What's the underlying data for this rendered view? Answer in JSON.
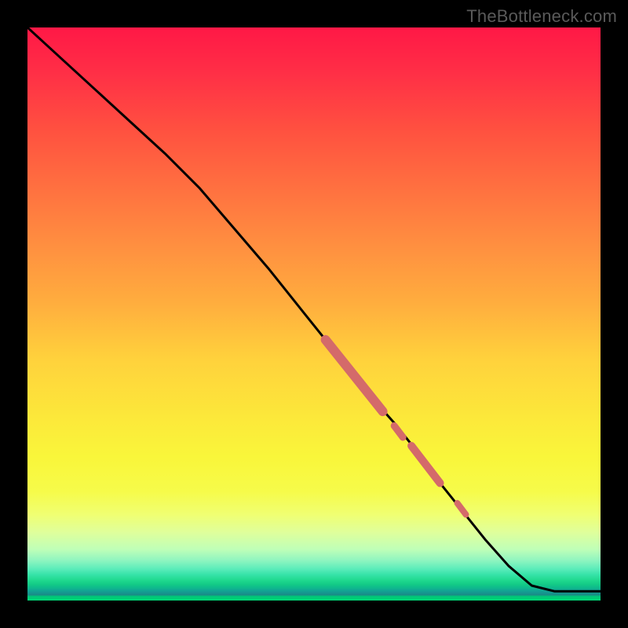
{
  "watermark": "TheBottleneck.com",
  "chart_data": {
    "type": "line",
    "title": "",
    "xlabel": "",
    "ylabel": "",
    "xlim": [
      0,
      100
    ],
    "ylim": [
      0,
      100
    ],
    "note": "Axes are unlabeled; values estimated from positions. y decreases from top (100) to bottom (0). Gradient background runs red (top) through orange/yellow to green (bottom).",
    "series": [
      {
        "name": "main-curve",
        "x": [
          0,
          6,
          12,
          18,
          24,
          30,
          36,
          42,
          48,
          54,
          56,
          60,
          64,
          68,
          72,
          76,
          80,
          84,
          88,
          92,
          94,
          100
        ],
        "y": [
          100,
          94.5,
          89,
          83.5,
          78,
          72,
          65,
          58,
          50.5,
          43,
          40.5,
          35.5,
          31,
          26,
          20.5,
          15.5,
          10.5,
          6,
          2.6,
          1.6,
          1.6,
          1.6
        ]
      }
    ],
    "highlights": [
      {
        "name": "thick-segment-1",
        "x_start": 52,
        "x_end": 62,
        "y_start": 45.5,
        "y_end": 33,
        "width": 12
      },
      {
        "name": "dot-1",
        "x_start": 64,
        "x_end": 65.5,
        "y_start": 30.5,
        "y_end": 28.5,
        "width": 9
      },
      {
        "name": "thick-segment-2",
        "x_start": 67,
        "x_end": 72,
        "y_start": 27,
        "y_end": 20.5,
        "width": 10
      },
      {
        "name": "dot-2",
        "x_start": 75,
        "x_end": 76.5,
        "y_start": 17,
        "y_end": 15,
        "width": 8
      }
    ],
    "gradient_stops": [
      {
        "pos": 0.0,
        "color": "#ff1846"
      },
      {
        "pos": 0.38,
        "color": "#ff8f40"
      },
      {
        "pos": 0.68,
        "color": "#fce83a"
      },
      {
        "pos": 0.95,
        "color": "#36e3a8"
      },
      {
        "pos": 1.0,
        "color": "#00d775"
      }
    ]
  }
}
